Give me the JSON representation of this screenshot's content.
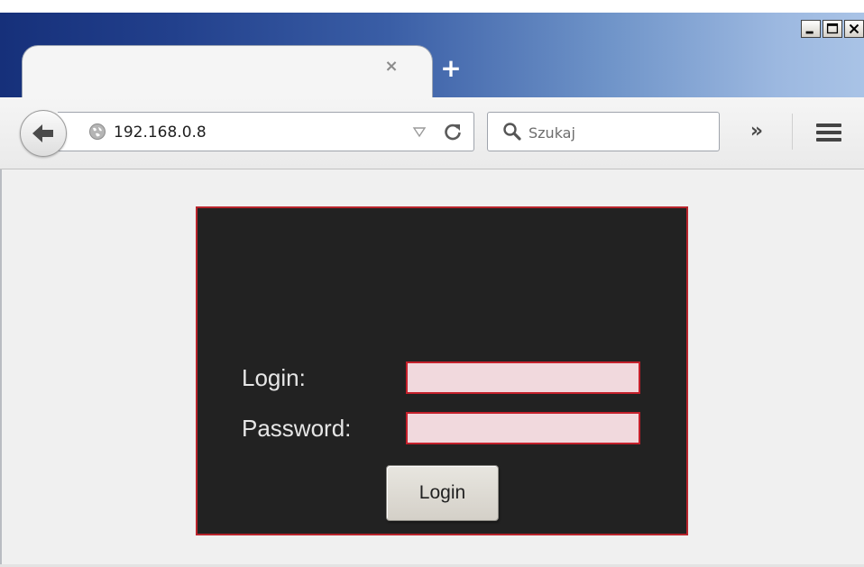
{
  "browser": {
    "tab": {
      "title": "",
      "close_glyph": "×"
    },
    "new_tab_glyph": "+",
    "address_bar": {
      "url": "192.168.0.8"
    },
    "search_bar": {
      "placeholder": "Szukaj"
    },
    "overflow_glyph": "»",
    "window_controls": [
      "minimize-icon",
      "maximize-icon",
      "close-icon"
    ]
  },
  "login_form": {
    "login_label": "Login:",
    "password_label": "Password:",
    "login_value": "",
    "password_value": "",
    "submit_label": "Login"
  },
  "colors": {
    "panel_background": "#222222",
    "panel_border": "#b8242c",
    "input_background": "#f1d9dd",
    "input_border": "#c4202b",
    "page_background": "#f0f0f0"
  }
}
